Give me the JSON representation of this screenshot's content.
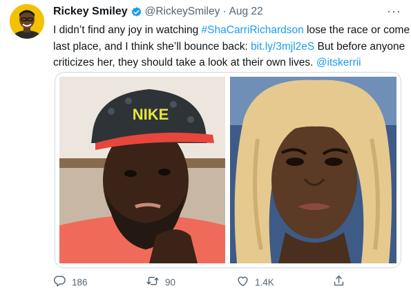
{
  "tweet": {
    "author_name": "Rickey Smiley",
    "handle": "@RickeySmiley",
    "separator": "·",
    "date": "Aug 22",
    "more_label": "···",
    "text": {
      "l1_a": "I didn’t find any joy in watching ",
      "l1_hashtag": "#ShaCarriRichardson",
      "l1_b": " lose the race or come",
      "l2_a": "last place, and I think she’ll bounce back: ",
      "l2_link": "bit.ly/3mjl2eS",
      "l2_b": " But before anyone",
      "l3_a": "criticizes her, they should take a look at their own lives. ",
      "l3_mention": "@itskerrii"
    },
    "media": {
      "left_cap_text": "NIKE"
    }
  },
  "actions": {
    "replies": "186",
    "retweets": "90",
    "likes": "1.4K"
  },
  "colors": {
    "accent": "#1d9bf0",
    "secondary_text": "#536471",
    "border": "#cfd9de"
  }
}
